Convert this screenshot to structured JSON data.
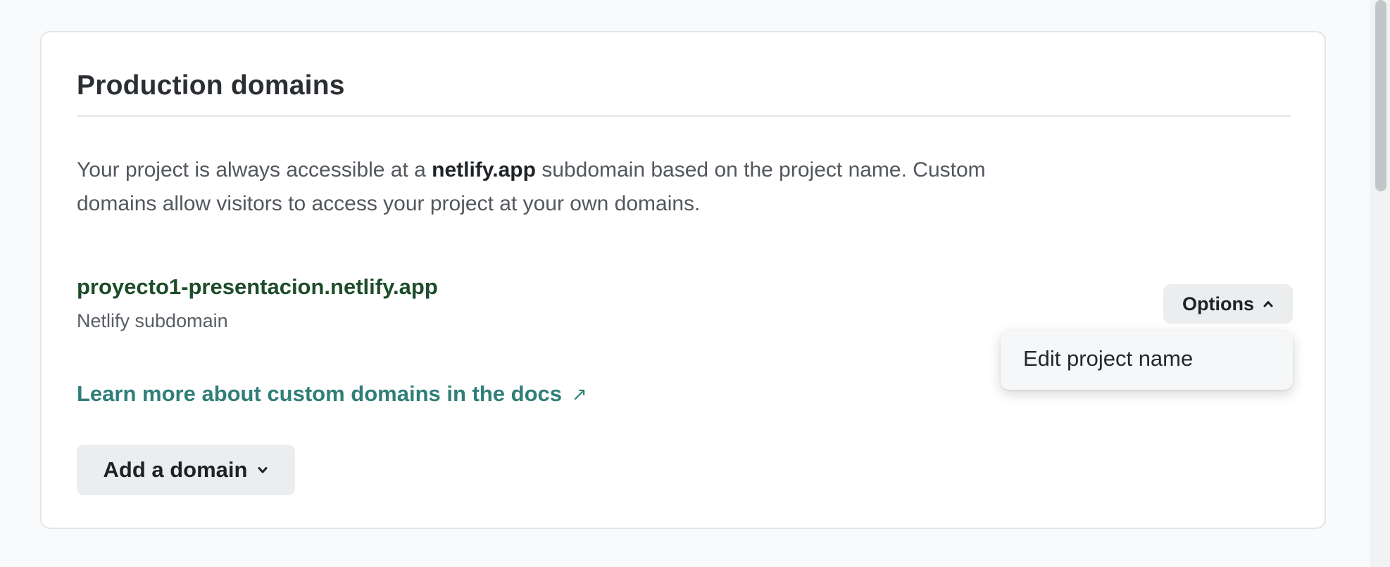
{
  "card": {
    "title": "Production domains",
    "description_prefix": "Your project is always accessible at a ",
    "description_bold": "netlify.app",
    "description_suffix": " subdomain based on the project name. Custom domains allow visitors to access your project at your own domains."
  },
  "domain": {
    "name": "proyecto1-presentacion.netlify.app",
    "type_label": "Netlify subdomain"
  },
  "options": {
    "label": "Options",
    "icon": "chevron-up-icon",
    "menu_items": [
      {
        "label": "Edit project name"
      }
    ]
  },
  "docs_link": {
    "label": "Learn more about custom domains in the docs",
    "icon": "external-link-icon",
    "glyph": "↗"
  },
  "add_domain": {
    "label": "Add a domain",
    "icon": "chevron-down-icon"
  },
  "colors": {
    "accent_link": "#2f7f78",
    "domain_green": "#1d4d2a"
  }
}
